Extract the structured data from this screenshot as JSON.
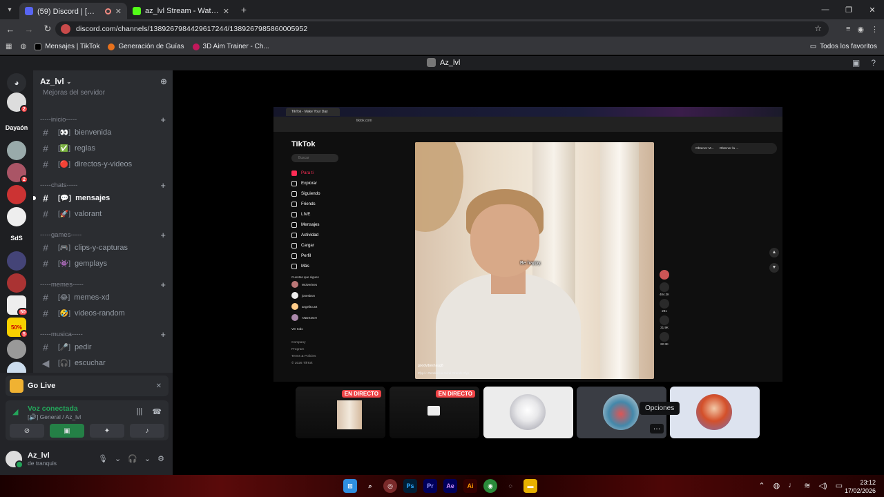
{
  "browser": {
    "tabs": [
      {
        "title": "(59) Discord | [🔊] General",
        "active": true
      },
      {
        "title": "az_lvl Stream - Watch Live on K",
        "active": false
      }
    ],
    "url": "discord.com/channels/1389267984429617244/1389267985860005952",
    "bookmarks": [
      "Mensajes | TikTok",
      "Generación de Guías",
      "3D Aim Trainer - Ch..."
    ],
    "bookmarks_right": "Todos los favoritos"
  },
  "discord": {
    "window_title": "Az_lvl",
    "server_name": "Az_lvl",
    "boost_text": "Mejoras del servidor",
    "servers": [
      {
        "label": "",
        "badge": "2"
      },
      {
        "label": "Dayaón",
        "badge": ""
      },
      {
        "label": "",
        "badge": ""
      },
      {
        "label": "",
        "badge": "2"
      },
      {
        "label": "",
        "badge": ""
      },
      {
        "label": "",
        "badge": ""
      },
      {
        "label": "SdS",
        "badge": ""
      },
      {
        "label": "",
        "badge": ""
      },
      {
        "label": "",
        "badge": ""
      },
      {
        "label": "",
        "badge": "50"
      },
      {
        "label": "",
        "badge": "5"
      },
      {
        "label": "",
        "badge": ""
      }
    ],
    "categories": [
      {
        "name": "-----inicio-----",
        "channels": [
          {
            "emoji": "[👀]",
            "name": "bienvenida",
            "bold": false
          },
          {
            "emoji": "[✅]",
            "name": "reglas",
            "bold": false
          },
          {
            "emoji": "[🔴]",
            "name": "directos-y-videos",
            "bold": false
          }
        ]
      },
      {
        "name": "-----chats-----",
        "channels": [
          {
            "emoji": "[💬]",
            "name": "mensajes",
            "bold": true
          },
          {
            "emoji": "[🚀]",
            "name": "valorant",
            "bold": false
          }
        ]
      },
      {
        "name": "-----games-----",
        "channels": [
          {
            "emoji": "[🎮]",
            "name": "clips-y-capturas",
            "bold": false
          },
          {
            "emoji": "[👾]",
            "name": "gemplays",
            "bold": false
          }
        ]
      },
      {
        "name": "-----memes-----",
        "channels": [
          {
            "emoji": "[😂]",
            "name": "memes-xd",
            "bold": false
          },
          {
            "emoji": "[🤣]",
            "name": "videos-random",
            "bold": false
          }
        ]
      },
      {
        "name": "-----musica-----",
        "channels": [
          {
            "emoji": "[🎤]",
            "name": "pedir",
            "bold": false
          },
          {
            "emoji": "[🎧]",
            "name": "escuchar",
            "bold": false
          }
        ]
      }
    ],
    "go_live": "Go Live",
    "voice": {
      "status": "Voz conectada",
      "channel": "[🔊] General / Az_lvl"
    },
    "user": {
      "name": "Az_lvl",
      "status": "de tranquis"
    },
    "tooltip": "Opciones",
    "live_badge": "EN DIRECTO"
  },
  "tiktok": {
    "logo": "TikTok",
    "search_placeholder": "Buscar",
    "nav": [
      "Para ti",
      "Explorar",
      "Siguiendo",
      "Friends",
      "LIVE",
      "Mensajes",
      "Actividad",
      "Cargar",
      "Perfil",
      "Más"
    ],
    "following_title": "Cuentas que sigues",
    "accounts": [
      "Wolverines",
      "jonesbsm",
      "angelito.art",
      "ANDX2GH"
    ],
    "see_all": "Ver todo",
    "footer": [
      "Company",
      "Program",
      "Terms & Policies",
      "© 2026 TikTok"
    ],
    "caption": "Be happy.",
    "video_user": "goodvibeshaug8",
    "video_desc": "#fypシ #tendencia #viral #trends #fyp",
    "counts": [
      "484.2K",
      "291",
      "31.9K",
      "22.3K"
    ],
    "top_buttons": [
      "Obtener M...",
      "Obtener la ..."
    ],
    "tab_title": "TikTok - Make Your Day",
    "addr": "tiktok.com"
  },
  "taskbar": {
    "time": "23:12",
    "date": "17/02/2026"
  },
  "colors": {
    "discord_bg": "#2b2d31",
    "accent_green": "#23a55a",
    "live_red": "#ed4245",
    "tiktok_red": "#fe2c55"
  }
}
